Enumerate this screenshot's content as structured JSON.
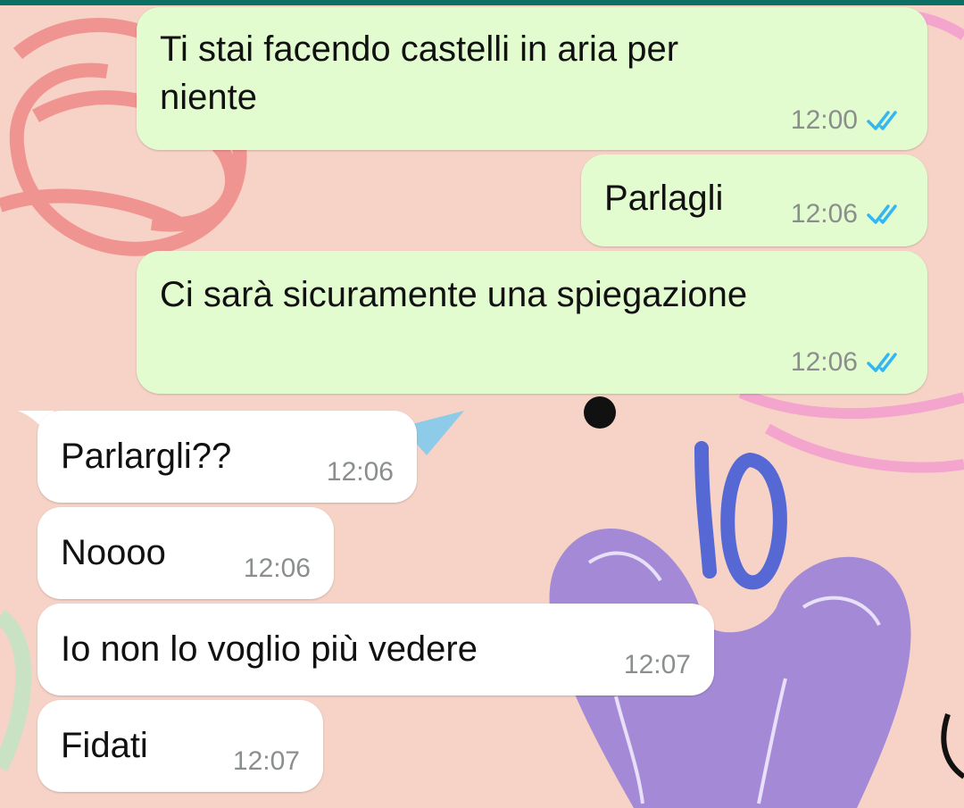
{
  "messages": [
    {
      "direction": "outgoing",
      "text": "Ti stai facendo castelli in aria per\nniente",
      "time": "12:00",
      "status": "read"
    },
    {
      "direction": "outgoing",
      "text": "Parlagli",
      "time": "12:06",
      "status": "read"
    },
    {
      "direction": "outgoing",
      "text": "Ci sarà sicuramente una spiegazione",
      "time": "12:06",
      "status": "read"
    },
    {
      "direction": "incoming",
      "text": "Parlargli??",
      "time": "12:06"
    },
    {
      "direction": "incoming",
      "text": "Noooo",
      "time": "12:06"
    },
    {
      "direction": "incoming",
      "text": "Io non lo voglio più vedere",
      "time": "12:07"
    },
    {
      "direction": "incoming",
      "text": "Fidati",
      "time": "12:07"
    }
  ],
  "annotation": {
    "text": "IO",
    "color": "#5568d4"
  },
  "colors": {
    "outgoing_bubble": "#e2fcd0",
    "incoming_bubble": "#ffffff",
    "read_ticks": "#34b7f1",
    "timestamp": "#8a8f8c",
    "header": "#0b6f63"
  },
  "icons": {
    "read_receipt": "double-check-icon"
  }
}
